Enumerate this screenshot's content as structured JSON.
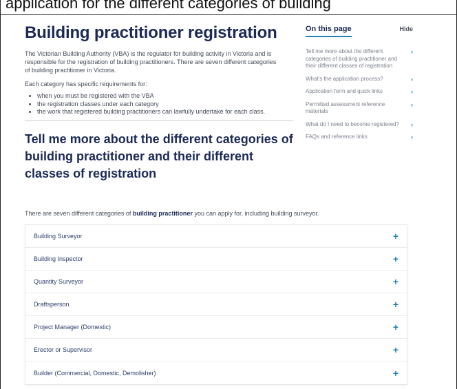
{
  "top_caption": "application for the different categories of building",
  "page": {
    "title": "Building practitioner registration",
    "intro": "The Victorian Building Authority (VBA) is the regulator for building activity in Victoria and is responsible for the registration of building practitioners. There are seven different categories of building practitioner in Victoria.",
    "requirements_lead": "Each category has specific requirements for:",
    "requirements": [
      "when you must be registered with the VBA",
      "the registration classes under each category",
      "the work that registered building practitioners can lawfully undertake for each class."
    ],
    "section_title": "Tell me more about the different categories of building practitioner and their different classes of registration",
    "section_intro_before": "There are seven different categories of ",
    "section_intro_bold": "building practitioner",
    "section_intro_after": " you can apply for, including building surveyor."
  },
  "accordion": {
    "expand_glyph": "+",
    "items": [
      "Building Surveyor",
      "Building Inspector",
      "Quantity Surveyor",
      "Draftsperson",
      "Project Manager (Domestic)",
      "Erector or Supervisor",
      "Builder (Commercial, Domestic, Demolisher)"
    ]
  },
  "toc": {
    "title": "On this page",
    "hide_label": "Hide",
    "chevron": "›",
    "items": [
      "Tell me more about the different categories of building practitioner and their different classes of registration",
      "What's the application process?",
      "Application form and quick links",
      "Permitted assessment reference materials",
      "What do I need to become registered?",
      "FAQs and reference links"
    ]
  },
  "colors": {
    "heading": "#1b2956",
    "accent": "#1f7fb8",
    "body_text": "#434b57",
    "toc_text": "#7b818b"
  }
}
